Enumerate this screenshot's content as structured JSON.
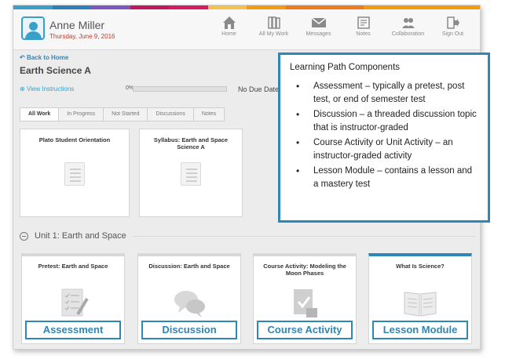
{
  "header": {
    "user_name": "Anne Miller",
    "date": "Thursday, June 9, 2016",
    "colorbar": [
      "#3aa0c8",
      "#2f7fb8",
      "#7e57c2",
      "#c2185b",
      "#d81b60",
      "#f2c14e",
      "#f39c12",
      "#f07b1b",
      "#f07b1b",
      "#f39c12",
      "#f39c12",
      "#f39c12"
    ],
    "nav": [
      {
        "label": "Home",
        "icon": "home-icon"
      },
      {
        "label": "All My Work",
        "icon": "books-icon"
      },
      {
        "label": "Messages",
        "icon": "envelope-icon"
      },
      {
        "label": "Notes",
        "icon": "notes-icon"
      },
      {
        "label": "Collaboration",
        "icon": "collaboration-icon"
      },
      {
        "label": "Sign Out",
        "icon": "sign-out-icon"
      }
    ]
  },
  "course": {
    "back_label": "Back to Home",
    "title": "Earth Science A",
    "view_instructions": "View Instructions",
    "progress_label": "0%",
    "progress_fraction": 0.0,
    "due_date": "No Due Date"
  },
  "tabs": [
    "All Work",
    "In Progress",
    "Not Started",
    "Discussions",
    "Notes"
  ],
  "top_cards": [
    {
      "title": "Plato Student Orientation"
    },
    {
      "title": "Syllabus: Earth and Space Science A"
    }
  ],
  "unit": {
    "title": "Unit 1: Earth and Space"
  },
  "unit_cards": [
    {
      "title": "Pretest: Earth and Space",
      "label": "Assessment",
      "icon": "checklist-icon"
    },
    {
      "title": "Discussion: Earth and Space",
      "label": "Discussion",
      "icon": "speech-bubbles-icon"
    },
    {
      "title": "Course Activity: Modeling the Moon Phases",
      "label": "Course Activity",
      "icon": "graded-document-icon"
    },
    {
      "title": "What Is Science?",
      "label": "Lesson Module",
      "icon": "open-book-icon"
    }
  ],
  "callout": {
    "title": "Learning Path Components",
    "items": [
      "Assessment – typically a pretest, post test, or end of semester test",
      "Discussion – a threaded discussion topic that is instructor-graded",
      "Course Activity or Unit Activity – an instructor-graded activity",
      "Lesson Module – contains a lesson and a mastery test"
    ]
  },
  "colors": {
    "accent": "#2f86b8",
    "link": "#3aa0c8",
    "date": "#c0392b"
  }
}
